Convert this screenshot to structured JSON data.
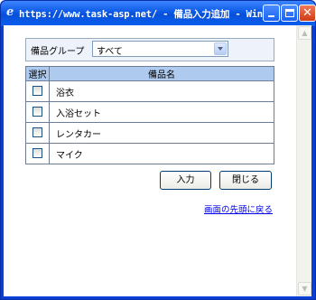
{
  "window": {
    "title": "https://www.task-asp.net/ - 備品入力追加 - Window...",
    "title_icon": "e",
    "controls": {
      "minimize": "minimize-icon",
      "maximize": "maximize-icon",
      "close": "close-icon"
    }
  },
  "group": {
    "label": "備品グループ",
    "selected": "すべて"
  },
  "table": {
    "headers": [
      "選択",
      "備品名"
    ],
    "rows": [
      {
        "name": "浴衣",
        "checked": false
      },
      {
        "name": "入浴セット",
        "checked": false
      },
      {
        "name": "レンタカー",
        "checked": false
      },
      {
        "name": "マイク",
        "checked": false
      }
    ]
  },
  "buttons": {
    "enter": "入力",
    "close": "閉じる"
  },
  "link": {
    "back_to_top": "画面の先頭に戻る"
  },
  "colors": {
    "titlebar": "#0b58e6",
    "table_header": "#aecbef",
    "link": "#0000ee"
  }
}
